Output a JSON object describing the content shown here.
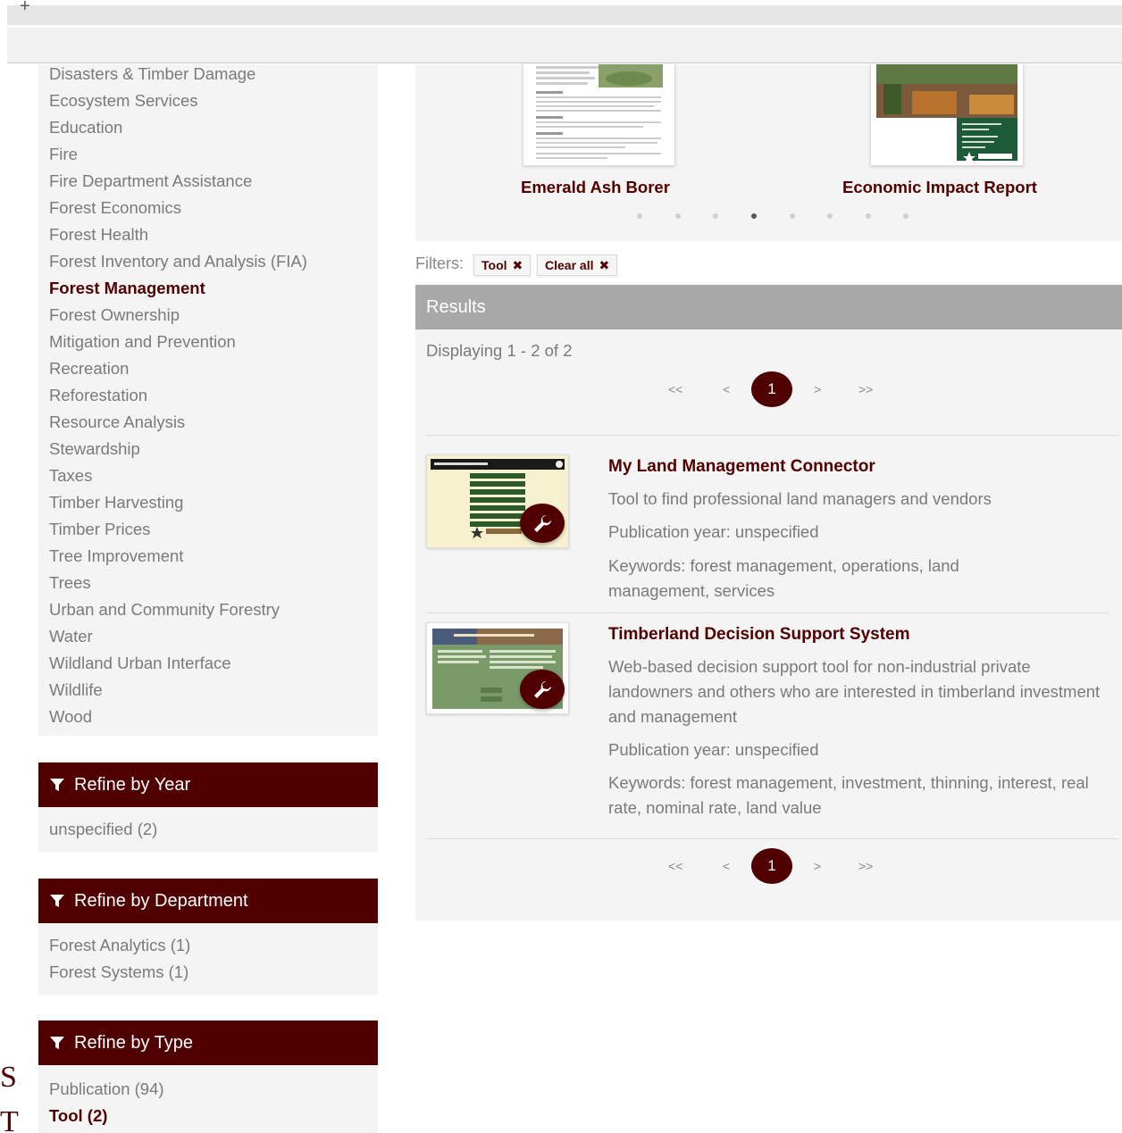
{
  "browser": {
    "new_tab_glyph": "+"
  },
  "edge": {
    "glyph1": "S",
    "glyph2": "T"
  },
  "topics": [
    {
      "label": "Disasters & Timber Damage",
      "active": false
    },
    {
      "label": "Ecosystem Services",
      "active": false
    },
    {
      "label": "Education",
      "active": false
    },
    {
      "label": "Fire",
      "active": false
    },
    {
      "label": "Fire Department Assistance",
      "active": false
    },
    {
      "label": "Forest Economics",
      "active": false
    },
    {
      "label": "Forest Health",
      "active": false
    },
    {
      "label": "Forest Inventory and Analysis (FIA)",
      "active": false
    },
    {
      "label": "Forest Management",
      "active": true
    },
    {
      "label": "Forest Ownership",
      "active": false
    },
    {
      "label": "Mitigation and Prevention",
      "active": false
    },
    {
      "label": "Recreation",
      "active": false
    },
    {
      "label": "Reforestation",
      "active": false
    },
    {
      "label": "Resource Analysis",
      "active": false
    },
    {
      "label": "Stewardship",
      "active": false
    },
    {
      "label": "Taxes",
      "active": false
    },
    {
      "label": "Timber Harvesting",
      "active": false
    },
    {
      "label": "Timber Prices",
      "active": false
    },
    {
      "label": "Tree Improvement",
      "active": false
    },
    {
      "label": "Trees",
      "active": false
    },
    {
      "label": "Urban and Community Forestry",
      "active": false
    },
    {
      "label": "Water",
      "active": false
    },
    {
      "label": "Wildland Urban Interface",
      "active": false
    },
    {
      "label": "Wildlife",
      "active": false
    },
    {
      "label": "Wood",
      "active": false
    }
  ],
  "refine_year": {
    "title": "Refine by Year",
    "items": [
      "unspecified (2)"
    ]
  },
  "refine_department": {
    "title": "Refine by Department",
    "items": [
      "Forest Analytics (1)",
      "Forest Systems (1)"
    ]
  },
  "refine_type": {
    "title": "Refine by Type",
    "items": [
      "Publication (94)",
      "Tool (2)"
    ]
  },
  "carousel": {
    "items": [
      {
        "caption": "Emerald Ash Borer"
      },
      {
        "caption": "Economic Impact Report"
      }
    ],
    "dot_count": 8,
    "active_dot": 3
  },
  "filters": {
    "label": "Filters:",
    "chips": [
      {
        "label": "Tool",
        "x": "✖"
      },
      {
        "label": "Clear all",
        "x": "✖"
      }
    ]
  },
  "results": {
    "header": "Results",
    "displaying": "Displaying 1 - 2 of 2",
    "pager": {
      "first": "<<",
      "prev": "<",
      "current": "1",
      "next": ">",
      "last": ">>"
    },
    "items": [
      {
        "title": "My Land Management Connector",
        "description": "Tool to find professional land managers and vendors",
        "year": "Publication year: unspecified",
        "keywords": "Keywords: forest management, operations, land management, services"
      },
      {
        "title": "Timberland Decision Support System",
        "description": "Web-based decision support tool for non-industrial private landowners and others who are interested in timberland investment and management",
        "year": "Publication year: unspecified",
        "keywords": "Keywords: forest management, investment, thinning, interest, real rate, nominal rate, land value"
      }
    ]
  },
  "colors": {
    "brand": "#500000",
    "panel": "#f4f4f4",
    "results_header": "#a8a8a8"
  }
}
